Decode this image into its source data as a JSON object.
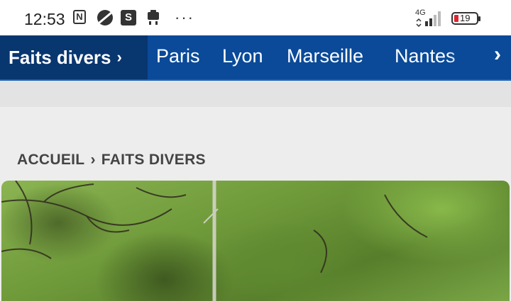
{
  "status_bar": {
    "time": "12:53",
    "icons": [
      "nfc-icon",
      "vpn-icon",
      "s-app-icon",
      "clipboard-icon",
      "more-icon"
    ],
    "more": "···",
    "s_label": "S",
    "nfc_label": "N",
    "network": "4G",
    "battery": "19"
  },
  "nav": {
    "active_section": "Faits divers",
    "links": [
      "Paris",
      "Lyon",
      "Marseille",
      "Nantes"
    ],
    "scroll_icon": "chevron-right-icon"
  },
  "breadcrumb": {
    "home": "ACCUEIL",
    "current": "FAITS DIVERS"
  },
  "colors": {
    "nav_bg": "#0a4a99",
    "nav_active_bg": "#08366f",
    "battery_low": "#e0242f"
  }
}
